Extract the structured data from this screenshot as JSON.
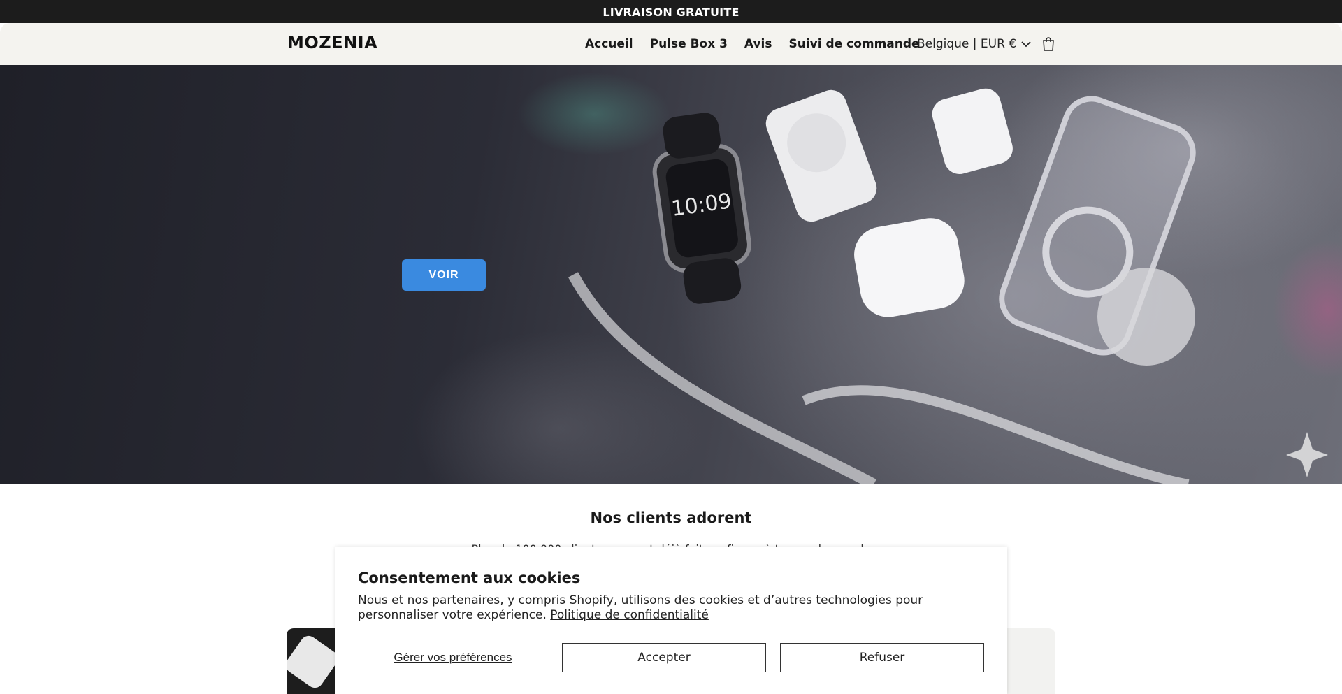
{
  "announcement": "LIVRAISON GRATUITE",
  "header": {
    "logo": "MOZENIA",
    "nav": [
      "Accueil",
      "Pulse Box 3",
      "Avis",
      "Suivi de commande"
    ],
    "locale": "Belgique | EUR €"
  },
  "hero": {
    "cta_label": "VOIR"
  },
  "reviews": {
    "title": "Nos clients adorent",
    "subtitle_partial": "Plus de 100 000 clients nous ont déjà fait confiance à travers le monde"
  },
  "cookie": {
    "title": "Consentement aux cookies",
    "body": "Nous et nos partenaires, y compris Shopify, utilisons des cookies et d’autres technologies pour personnaliser votre expérience.",
    "policy_link": "Politique de confidentialité",
    "manage_label": "Gérer vos préférences",
    "accept_label": "Accepter",
    "refuse_label": "Refuser"
  },
  "colors": {
    "announcement_bg": "#1c1c1c",
    "header_bg": "#f4f3ef",
    "cta_bg": "#3a8ae0"
  },
  "icons": [
    "chevron-down-icon",
    "cart-icon"
  ]
}
